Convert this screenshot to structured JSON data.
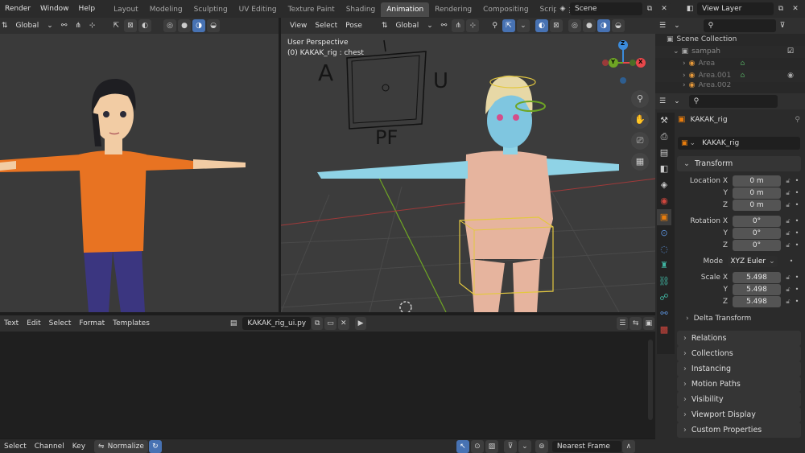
{
  "topbar": {
    "menus": [
      "Render",
      "Window",
      "Help"
    ],
    "workspaces": [
      "Layout",
      "Modeling",
      "Sculpting",
      "UV Editing",
      "Texture Paint",
      "Shading",
      "Animation",
      "Rendering",
      "Compositing",
      "Scripting"
    ],
    "active_workspace": "Animation",
    "add_tab": "+",
    "scene_name": "Scene",
    "view_layer": "View Layer"
  },
  "left_viewport": {
    "orientation": "Global"
  },
  "main_viewport": {
    "menus": [
      "View",
      "Select",
      "Pose"
    ],
    "orientation": "Global",
    "overlay_line1": "User Perspective",
    "overlay_line2": "(0) KAKAK_rig : chest",
    "overlay_letters": [
      "A",
      "U",
      "PF"
    ],
    "gizmo_axes": {
      "x": "X",
      "y": "Y",
      "z": "Z"
    }
  },
  "outliner": {
    "root": "Scene Collection",
    "collection": "sampah",
    "items": [
      "Area",
      "Area.001",
      "Area.002"
    ]
  },
  "properties": {
    "object_name": "KAKAK_rig",
    "data_name": "KAKAK_rig",
    "transform_title": "Transform",
    "location": {
      "label": "Location X",
      "y_label": "Y",
      "z_label": "Z",
      "x": "0 m",
      "y": "0 m",
      "z": "0 m"
    },
    "rotation": {
      "label": "Rotation X",
      "y_label": "Y",
      "z_label": "Z",
      "x": "0°",
      "y": "0°",
      "z": "0°"
    },
    "mode_label": "Mode",
    "mode_value": "XYZ Euler",
    "scale": {
      "label": "Scale X",
      "y_label": "Y",
      "z_label": "Z",
      "x": "5.498",
      "y": "5.498",
      "z": "5.498"
    },
    "delta_transform": "Delta Transform",
    "panels": [
      "Relations",
      "Collections",
      "Instancing",
      "Motion Paths",
      "Visibility",
      "Viewport Display",
      "Custom Properties"
    ]
  },
  "text_editor": {
    "menus": [
      "Text",
      "Edit",
      "Select",
      "Format",
      "Templates"
    ],
    "file_name": "KAKAK_rig_ui.py"
  },
  "timeline": {
    "menus": [
      "Select",
      "Channel",
      "Key"
    ],
    "normalize": "Normalize",
    "snap_mode": "Nearest Frame"
  },
  "colors": {
    "accent_blue": "#4772b3",
    "active_orange": "#e87d0d",
    "axis_x": "#e8474a",
    "axis_y": "#6ea524",
    "axis_z": "#3b8bdb"
  }
}
